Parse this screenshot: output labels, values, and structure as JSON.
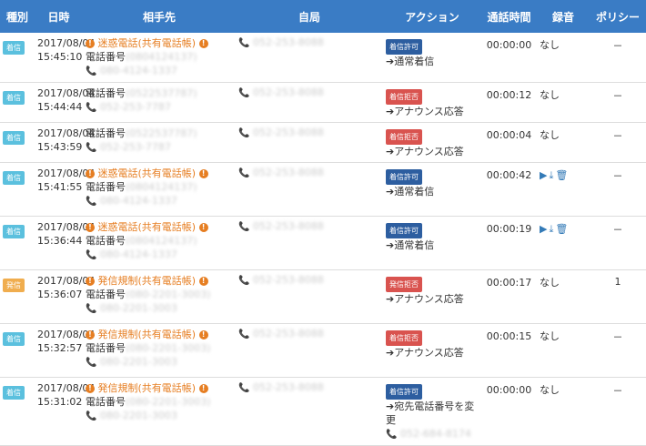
{
  "headers": [
    "種別",
    "日時",
    "相手先",
    "自局",
    "アクション",
    "通話時間",
    "録音",
    "ポリシー"
  ],
  "rows": [
    {
      "kind": "着信",
      "kind_class": "k-in",
      "date": "2017/08/04",
      "time": "15:45:10",
      "label": "迷惑電話(共有電話帳)",
      "label_color": "orange",
      "tel_prefix": "電話番号",
      "tel": "(0804124137)",
      "tel2": "080-4124-1337",
      "self": "052-253-8088",
      "badge": "着信許可",
      "badge_class": "b-allow",
      "action": "➔通常着信",
      "action2": "",
      "duration": "00:00:00",
      "recording": "なし",
      "policy": "－"
    },
    {
      "kind": "着信",
      "kind_class": "k-in",
      "date": "2017/08/04",
      "time": "15:44:44",
      "label": "",
      "label_color": "",
      "tel_prefix": "電話番号",
      "tel": "(0522537787)",
      "tel2": "052-253-7787",
      "self": "052-253-8088",
      "badge": "着信拒否",
      "badge_class": "b-reject",
      "action": "➔アナウンス応答",
      "action2": "",
      "duration": "00:00:12",
      "recording": "なし",
      "policy": "－"
    },
    {
      "kind": "着信",
      "kind_class": "k-in",
      "date": "2017/08/04",
      "time": "15:43:59",
      "label": "",
      "label_color": "",
      "tel_prefix": "電話番号",
      "tel": "(0522537787)",
      "tel2": "052-253-7787",
      "self": "052-253-8088",
      "badge": "着信拒否",
      "badge_class": "b-reject",
      "action": "➔アナウンス応答",
      "action2": "",
      "duration": "00:00:04",
      "recording": "なし",
      "policy": "－"
    },
    {
      "kind": "着信",
      "kind_class": "k-in",
      "date": "2017/08/04",
      "time": "15:41:55",
      "label": "迷惑電話(共有電話帳)",
      "label_color": "orange",
      "tel_prefix": "電話番号",
      "tel": "(0804124137)",
      "tel2": "080-4124-1337",
      "self": "052-253-8088",
      "badge": "着信許可",
      "badge_class": "b-allow",
      "action": "➔通常着信",
      "action2": "",
      "duration": "00:00:42",
      "recording": "",
      "policy": "－",
      "has_icons": true
    },
    {
      "kind": "着信",
      "kind_class": "k-in",
      "date": "2017/08/04",
      "time": "15:36:44",
      "label": "迷惑電話(共有電話帳)",
      "label_color": "orange",
      "tel_prefix": "電話番号",
      "tel": "(0804124137)",
      "tel2": "080-4124-1337",
      "self": "052-253-8088",
      "badge": "着信許可",
      "badge_class": "b-allow",
      "action": "➔通常着信",
      "action2": "",
      "duration": "00:00:19",
      "recording": "",
      "policy": "－",
      "has_icons": true
    },
    {
      "kind": "発信",
      "kind_class": "k-out",
      "date": "2017/08/04",
      "time": "15:36:07",
      "label": "発信規制(共有電話帳)",
      "label_color": "orange",
      "tel_prefix": "電話番号",
      "tel": "(080-2201-3003)",
      "tel2": "080-2201-3003",
      "self": "052-253-8088",
      "badge": "発信拒否",
      "badge_class": "b-reject",
      "action": "➔アナウンス応答",
      "action2": "",
      "duration": "00:00:17",
      "recording": "なし",
      "policy": "1"
    },
    {
      "kind": "着信",
      "kind_class": "k-in",
      "date": "2017/08/04",
      "time": "15:32:57",
      "label": "発信規制(共有電話帳)",
      "label_color": "orange",
      "tel_prefix": "電話番号",
      "tel": "(080-2201-3003)",
      "tel2": "080-2201-3003",
      "self": "052-253-8088",
      "badge": "着信拒否",
      "badge_class": "b-reject",
      "action": "➔アナウンス応答",
      "action2": "",
      "duration": "00:00:15",
      "recording": "なし",
      "policy": "－"
    },
    {
      "kind": "着信",
      "kind_class": "k-in",
      "date": "2017/08/04",
      "time": "15:31:02",
      "label": "発信規制(共有電話帳)",
      "label_color": "orange",
      "tel_prefix": "電話番号",
      "tel": "(080-2201-3003)",
      "tel2": "080-2201-3003",
      "self": "052-253-8088",
      "badge": "着信許可",
      "badge_class": "b-allow",
      "action": "➔宛先電話番号を変更",
      "action2": "052-684-8174",
      "duration": "00:00:00",
      "recording": "なし",
      "policy": "－"
    }
  ],
  "icons": {
    "play": "▶",
    "download": "⤓",
    "delete": "🗑"
  }
}
